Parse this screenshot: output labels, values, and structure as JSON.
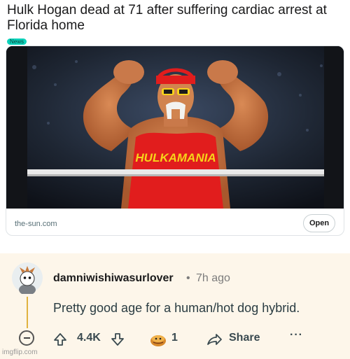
{
  "post": {
    "title": "Hulk Hogan dead at 71 after suffering cardiac arrest at Florida home",
    "flair": "News",
    "link": {
      "domain": "the-sun.com",
      "open_label": "Open",
      "image_text": "HULKAMANIA"
    }
  },
  "comment": {
    "username": "damniwishiwasurlover",
    "separator": "•",
    "timestamp": "7h ago",
    "body": "Pretty good age for a human/hot dog hybrid.",
    "actions": {
      "score": "4.4K",
      "award_count": "1",
      "share_label": "Share",
      "more_label": "···"
    },
    "thread_color": "#e0b33f"
  },
  "watermark": "imgflip.com",
  "icons": [
    "upvote-icon",
    "downvote-icon",
    "award-icon",
    "share-icon",
    "more-icon",
    "collapse-icon",
    "avatar"
  ]
}
